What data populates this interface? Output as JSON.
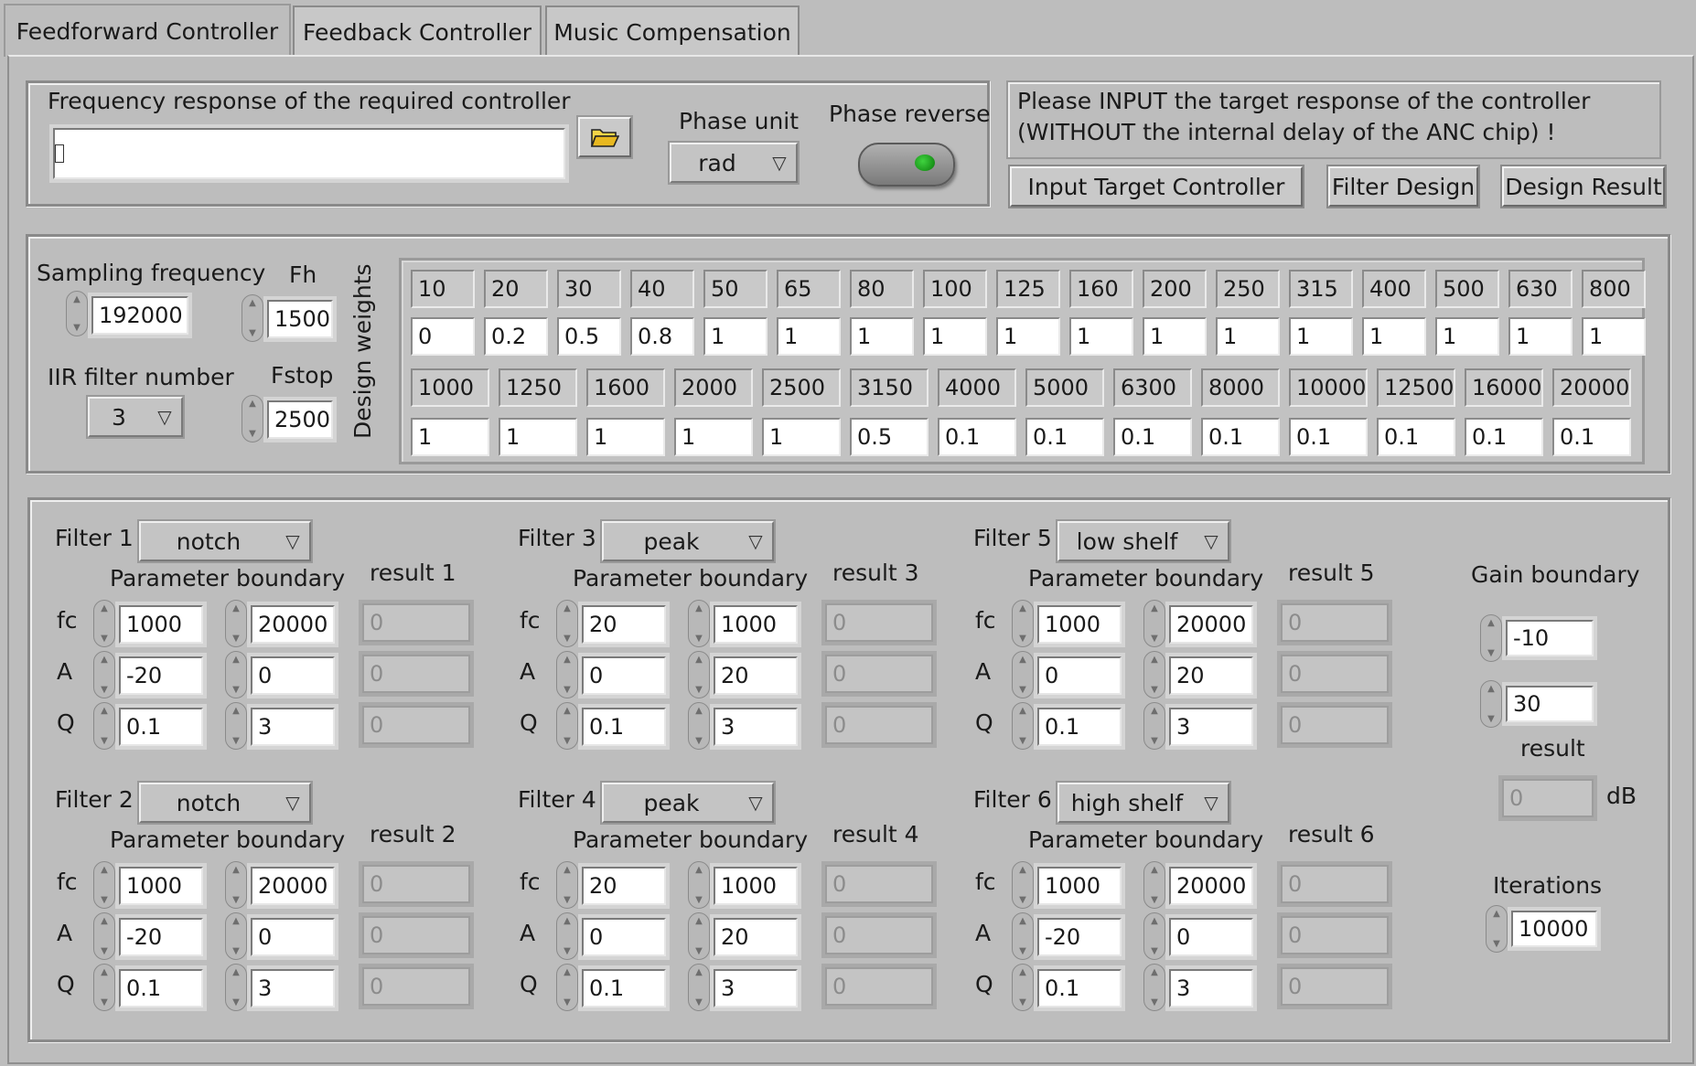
{
  "tabs": [
    "Feedforward Controller",
    "Feedback Controller",
    "Music Compensation"
  ],
  "path_group": {
    "title": "Frequency response of the required controller",
    "path_value": "",
    "phase_unit_label": "Phase unit",
    "phase_unit_value": "rad",
    "phase_reverse_label": "Phase reverse"
  },
  "info": {
    "line1": "Please INPUT the target response of the controller",
    "line2": "(WITHOUT the internal delay of the ANC chip) !"
  },
  "buttons": {
    "input_target": "Input Target Controller",
    "filter_design": "Filter Design",
    "design_result": "Design Result"
  },
  "params": {
    "fs_label": "Sampling frequency",
    "fs_value": "192000",
    "fh_label": "Fh",
    "fh_value": "1500",
    "iir_label": "IIR filter number",
    "iir_value": "3",
    "fstop_label": "Fstop",
    "fstop_value": "2500",
    "weights_label": "Design weights"
  },
  "weights_row1": {
    "freqs": [
      "10",
      "20",
      "30",
      "40",
      "50",
      "65",
      "80",
      "100",
      "125",
      "160",
      "200",
      "250",
      "315",
      "400",
      "500",
      "630",
      "800"
    ],
    "weights": [
      "0",
      "0.2",
      "0.5",
      "0.8",
      "1",
      "1",
      "1",
      "1",
      "1",
      "1",
      "1",
      "1",
      "1",
      "1",
      "1",
      "1",
      "1"
    ]
  },
  "weights_row2": {
    "freqs": [
      "1000",
      "1250",
      "1600",
      "2000",
      "2500",
      "3150",
      "4000",
      "5000",
      "6300",
      "8000",
      "10000",
      "12500",
      "16000",
      "20000"
    ],
    "weights": [
      "1",
      "1",
      "1",
      "1",
      "1",
      "0.5",
      "0.1",
      "0.1",
      "0.1",
      "0.1",
      "0.1",
      "0.1",
      "0.1",
      "0.1"
    ]
  },
  "filters": [
    {
      "label": "Filter 1",
      "type": "notch",
      "pb": "Parameter boundary",
      "result": "result 1",
      "lo": [
        "1000",
        "-20",
        "0.1"
      ],
      "hi": [
        "20000",
        "0",
        "3"
      ],
      "res": [
        "0",
        "0",
        "0"
      ]
    },
    {
      "label": "Filter 2",
      "type": "notch",
      "pb": "Parameter boundary",
      "result": "result 2",
      "lo": [
        "1000",
        "-20",
        "0.1"
      ],
      "hi": [
        "20000",
        "0",
        "3"
      ],
      "res": [
        "0",
        "0",
        "0"
      ]
    },
    {
      "label": "Filter 3",
      "type": "peak",
      "pb": "Parameter boundary",
      "result": "result 3",
      "lo": [
        "20",
        "0",
        "0.1"
      ],
      "hi": [
        "1000",
        "20",
        "3"
      ],
      "res": [
        "0",
        "0",
        "0"
      ]
    },
    {
      "label": "Filter 4",
      "type": "peak",
      "pb": "Parameter boundary",
      "result": "result 4",
      "lo": [
        "20",
        "0",
        "0.1"
      ],
      "hi": [
        "1000",
        "20",
        "3"
      ],
      "res": [
        "0",
        "0",
        "0"
      ]
    },
    {
      "label": "Filter 5",
      "type": "low shelf",
      "pb": "Parameter boundary",
      "result": "result 5",
      "lo": [
        "1000",
        "0",
        "0.1"
      ],
      "hi": [
        "20000",
        "20",
        "3"
      ],
      "res": [
        "0",
        "0",
        "0"
      ]
    },
    {
      "label": "Filter 6",
      "type": "high shelf",
      "pb": "Parameter boundary",
      "result": "result 6",
      "lo": [
        "1000",
        "-20",
        "0.1"
      ],
      "hi": [
        "20000",
        "0",
        "3"
      ],
      "res": [
        "0",
        "0",
        "0"
      ]
    }
  ],
  "row_labels": [
    "fc",
    "A",
    "Q"
  ],
  "gain": {
    "label": "Gain boundary",
    "lo": "-10",
    "hi": "30",
    "result_label": "result",
    "result_value": "0",
    "unit": "dB",
    "iter_label": "Iterations",
    "iter_value": "10000"
  }
}
